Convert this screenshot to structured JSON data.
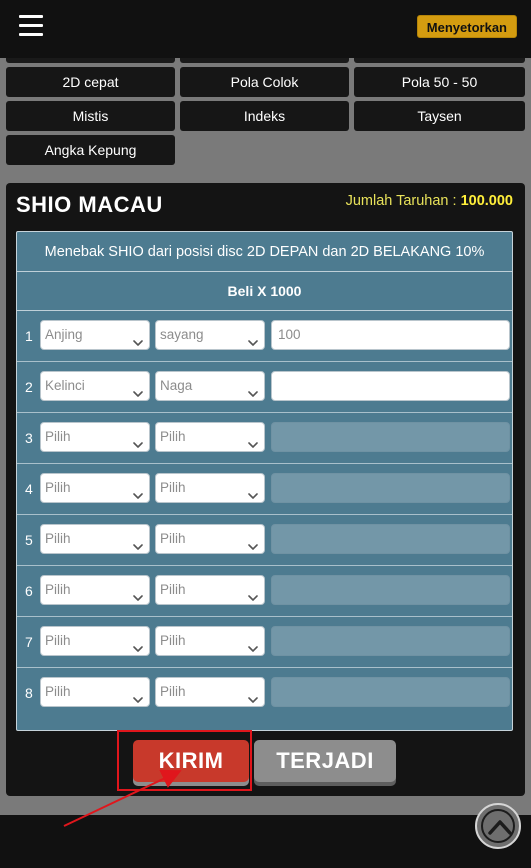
{
  "header": {
    "deposit_label": "Menyetorkan"
  },
  "menu": [
    {
      "label": "2D cepat"
    },
    {
      "label": "Pola Colok"
    },
    {
      "label": "Pola 50 - 50"
    },
    {
      "label": "Mistis"
    },
    {
      "label": "Indeks"
    },
    {
      "label": "Taysen"
    },
    {
      "label": "Angka Kepung"
    }
  ],
  "panel": {
    "title": "SHIO MACAU",
    "bet_total_label": "Jumlah Taruhan :",
    "bet_total_value": "100.000",
    "description": "Menebak SHIO dari posisi disc 2D DEPAN dan 2D BELAKANG 10%",
    "multiplier": "Beli X 1000"
  },
  "rows": [
    {
      "num": "1",
      "select1": "Anjing",
      "select2": "sayang",
      "amount": "100",
      "enabled": true
    },
    {
      "num": "2",
      "select1": "Kelinci",
      "select2": "Naga",
      "amount": "",
      "enabled": true
    },
    {
      "num": "3",
      "select1": "Pilih",
      "select2": "Pilih",
      "amount": "",
      "enabled": false
    },
    {
      "num": "4",
      "select1": "Pilih",
      "select2": "Pilih",
      "amount": "",
      "enabled": false
    },
    {
      "num": "5",
      "select1": "Pilih",
      "select2": "Pilih",
      "amount": "",
      "enabled": false
    },
    {
      "num": "6",
      "select1": "Pilih",
      "select2": "Pilih",
      "amount": "",
      "enabled": false
    },
    {
      "num": "7",
      "select1": "Pilih",
      "select2": "Pilih",
      "amount": "",
      "enabled": false
    },
    {
      "num": "8",
      "select1": "Pilih",
      "select2": "Pilih",
      "amount": "",
      "enabled": false
    }
  ],
  "actions": {
    "submit_label": "KIRIM",
    "result_label": "TERJADI"
  },
  "icons": {
    "menu": "hamburger-icon",
    "dropdown": "chevron-down-icon",
    "scroll_top": "chevron-up-icon"
  },
  "colors": {
    "accent": "#d49c10",
    "submit": "#c8392b",
    "table": "#4d7b90",
    "highlight": "#e0161c"
  }
}
